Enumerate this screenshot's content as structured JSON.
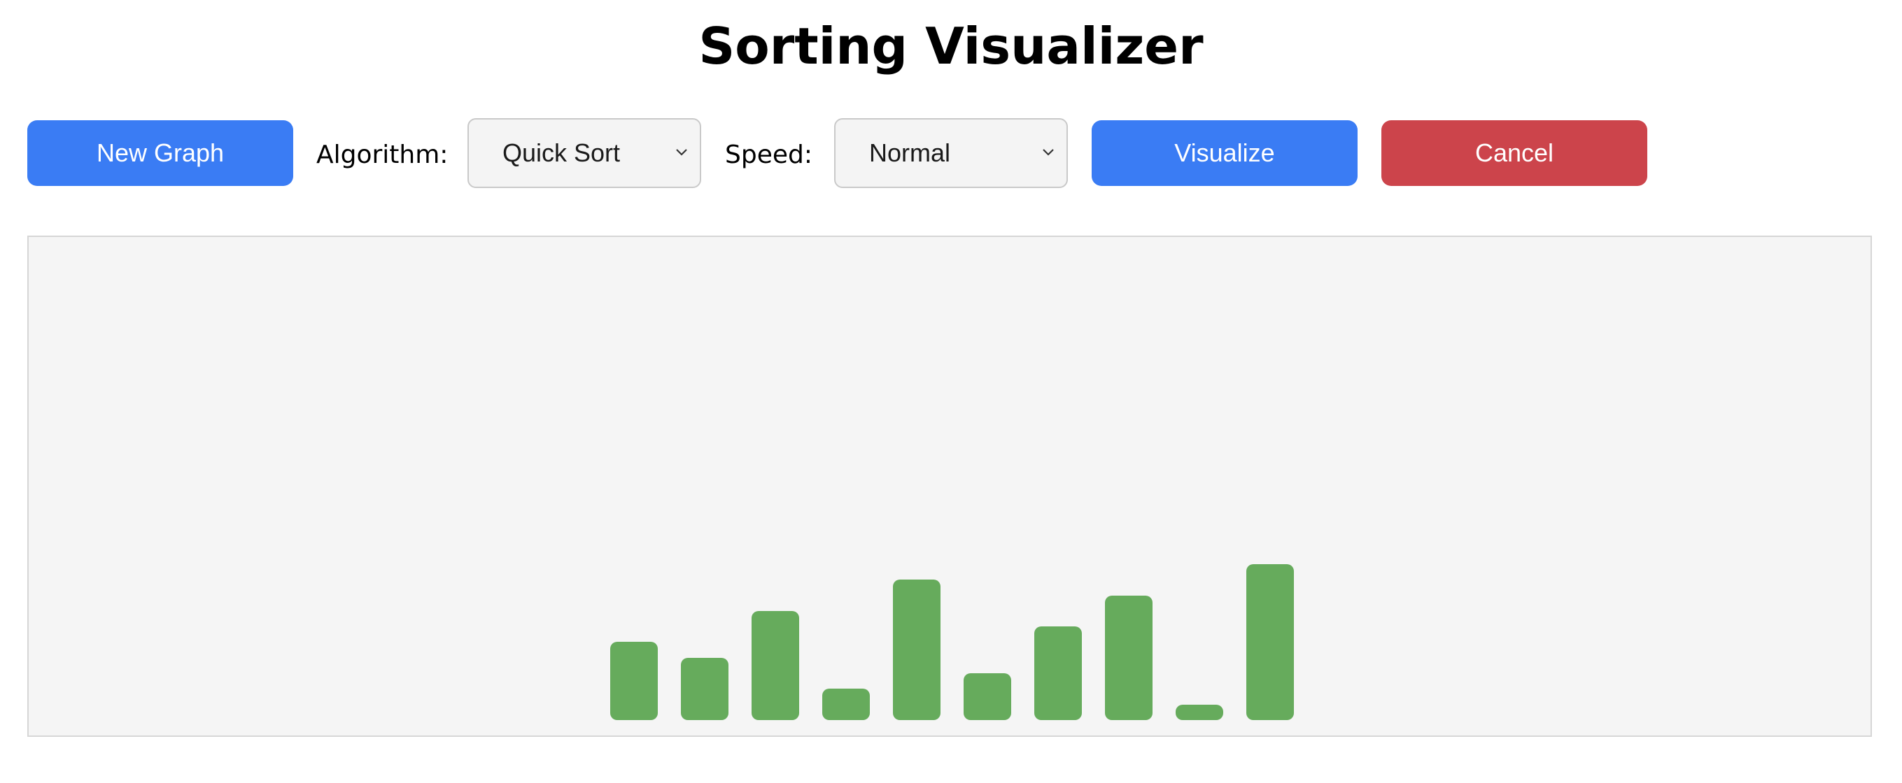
{
  "page_title": "Sorting Visualizer",
  "toolbar": {
    "new_graph_label": "New Graph",
    "algorithm_label": "Algorithm:",
    "algorithm_selected": "Quick Sort",
    "speed_label": "Speed:",
    "speed_selected": "Normal",
    "visualize_label": "Visualize",
    "cancel_label": "Cancel"
  },
  "icons": {
    "dropdown": "chevron-down-icon"
  },
  "colors": {
    "primary_button": "#3a7cf4",
    "cancel_button": "#cc444b",
    "bar": "#66ab5c",
    "canvas_background": "#f5f5f5"
  },
  "graph": {
    "max_value": 10,
    "bar_values": [
      5,
      4,
      7,
      2,
      9,
      3,
      6,
      8,
      1,
      10
    ]
  }
}
